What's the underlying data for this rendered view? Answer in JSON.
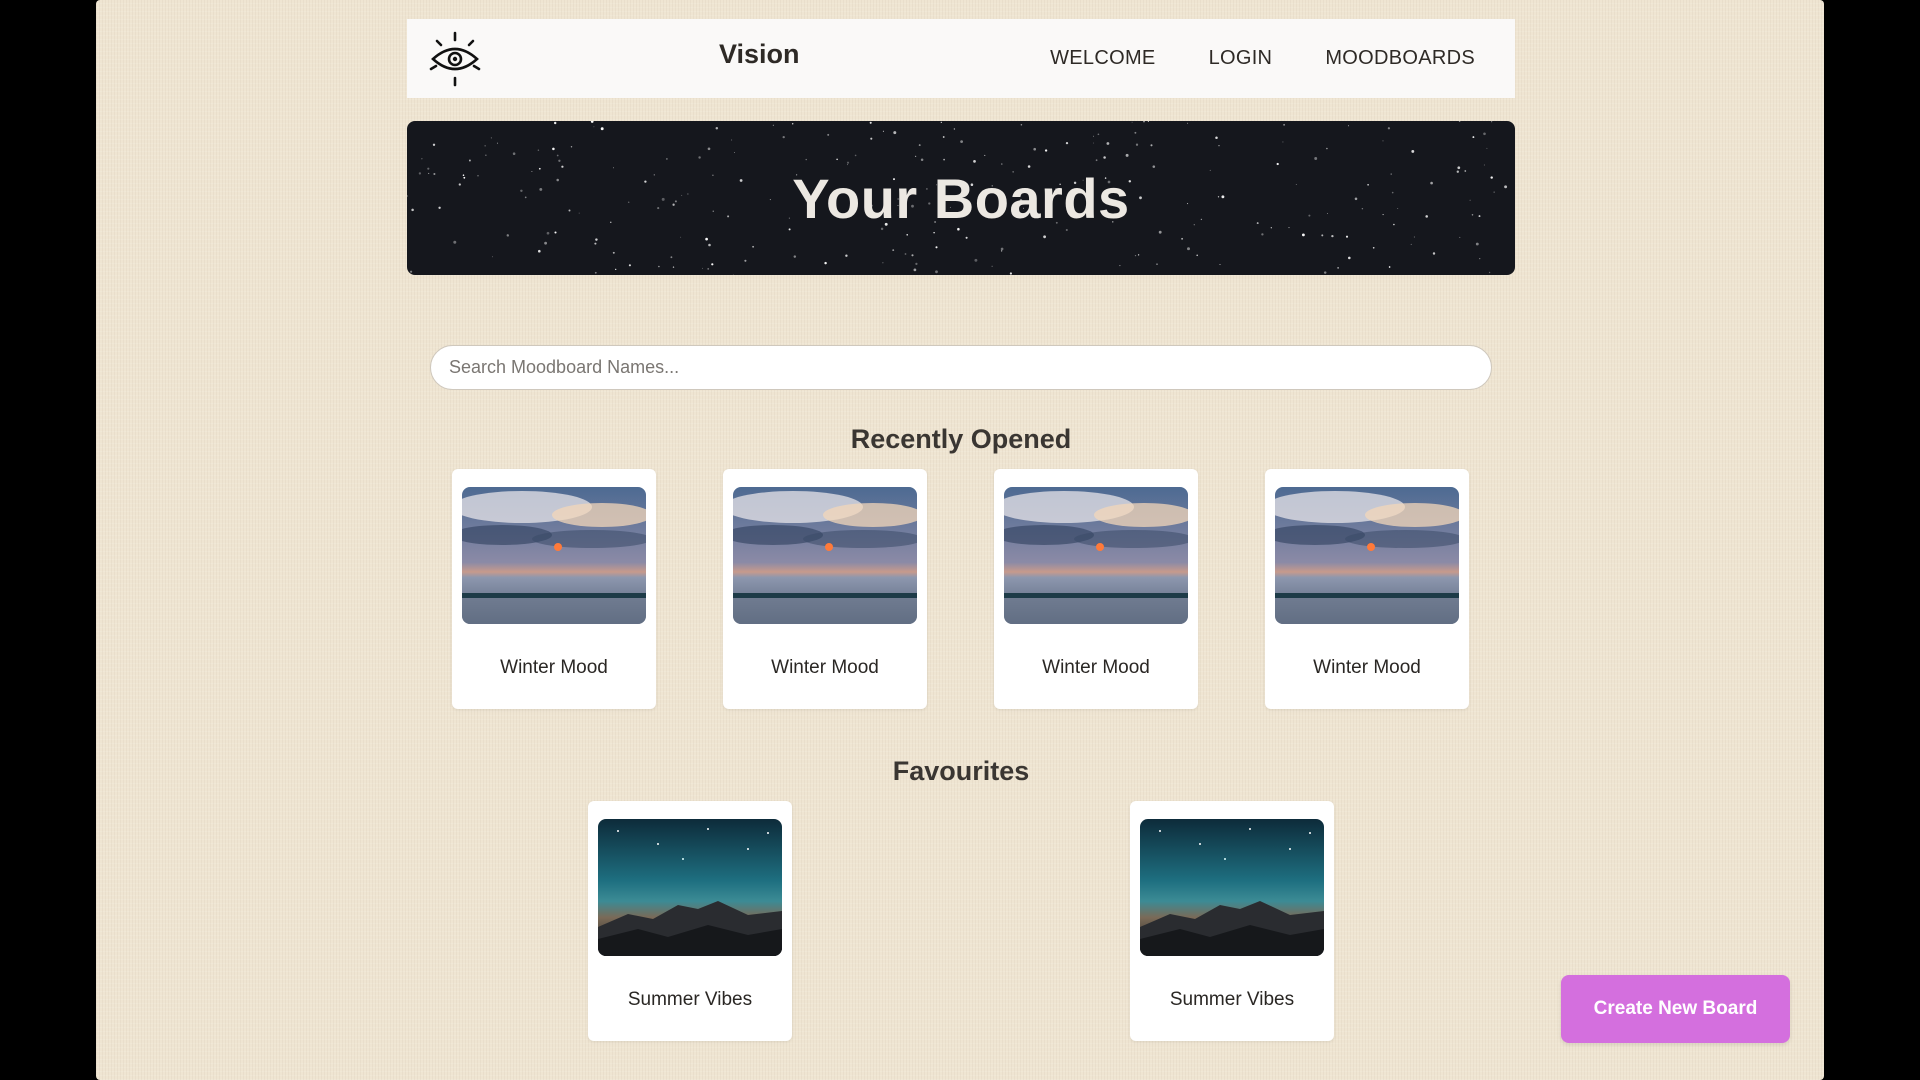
{
  "nav": {
    "brand": "Vision",
    "links": [
      "WELCOME",
      "LOGIN",
      "MOODBOARDS"
    ]
  },
  "hero": {
    "title": "Your Boards"
  },
  "search": {
    "placeholder": "Search Moodboard Names..."
  },
  "recent": {
    "title": "Recently Opened",
    "boards": [
      {
        "name": "Winter Mood"
      },
      {
        "name": "Winter Mood"
      },
      {
        "name": "Winter Mood"
      },
      {
        "name": "Winter Mood"
      }
    ]
  },
  "favourites": {
    "title": "Favourites",
    "boards": [
      {
        "name": "Summer Vibes"
      },
      {
        "name": "Summer Vibes"
      }
    ]
  },
  "actions": {
    "create_label": "Create New Board"
  },
  "colors": {
    "accent": "#d46fde",
    "background": "#efe5d2",
    "hero": "#15171d"
  }
}
